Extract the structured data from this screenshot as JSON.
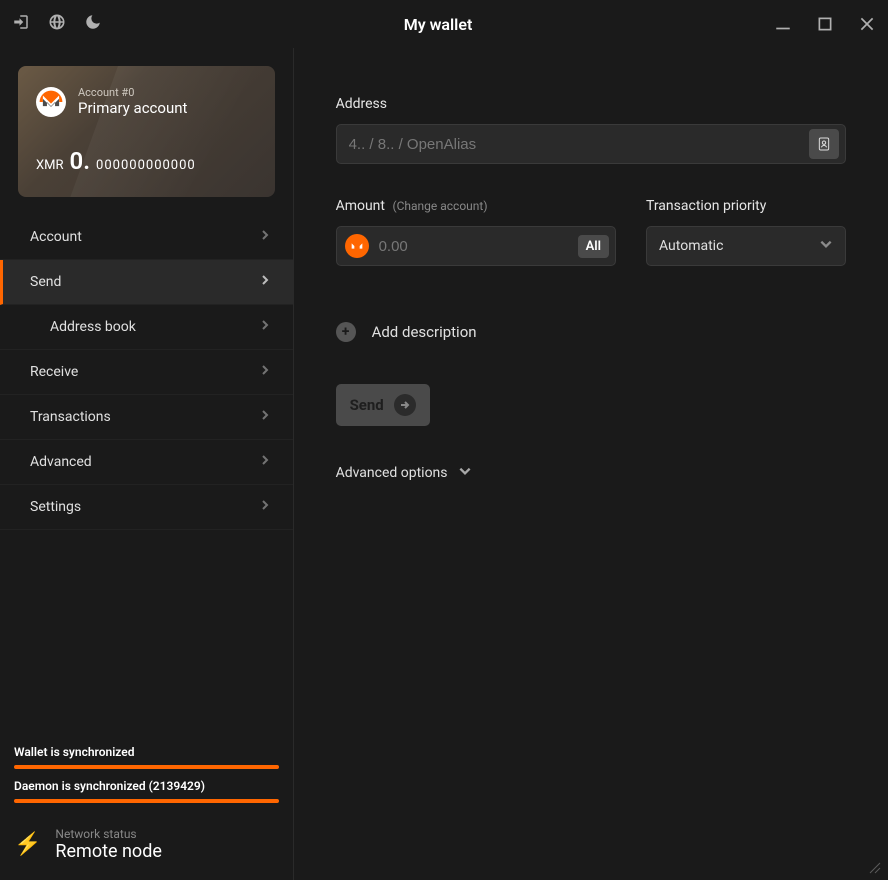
{
  "window": {
    "title": "My wallet"
  },
  "account": {
    "number_label": "Account #0",
    "name": "Primary account",
    "balance_symbol": "XMR",
    "balance_int": "0.",
    "balance_dec": "000000000000"
  },
  "nav": {
    "account": "Account",
    "send": "Send",
    "address_book": "Address book",
    "receive": "Receive",
    "transactions": "Transactions",
    "advanced": "Advanced",
    "settings": "Settings"
  },
  "sync": {
    "wallet_label": "Wallet is synchronized",
    "daemon_label": "Daemon is synchronized (2139429)"
  },
  "network": {
    "status_label": "Network status",
    "status_value": "Remote node"
  },
  "send": {
    "address_label": "Address",
    "address_placeholder": "4.. / 8.. / OpenAlias",
    "amount_label": "Amount",
    "amount_sublabel": "(Change account)",
    "amount_placeholder": "0.00",
    "all_button": "All",
    "priority_label": "Transaction priority",
    "priority_value": "Automatic",
    "add_description": "Add description",
    "send_button": "Send",
    "advanced_options": "Advanced options"
  }
}
